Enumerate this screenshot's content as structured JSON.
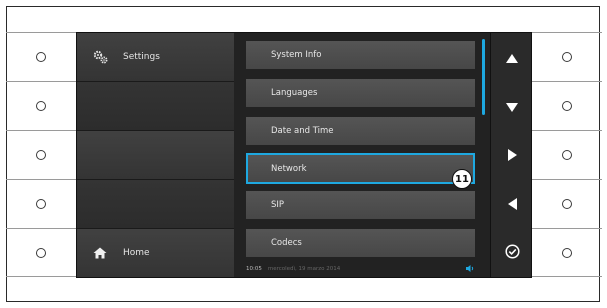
{
  "sidebar": {
    "settings_label": "Settings",
    "home_label": "Home"
  },
  "menu": {
    "items": [
      {
        "label": "System Info"
      },
      {
        "label": "Languages"
      },
      {
        "label": "Date and Time"
      },
      {
        "label": "Network"
      },
      {
        "label": "SIP"
      },
      {
        "label": "Codecs"
      }
    ],
    "selected": "Network",
    "callout_number": "11"
  },
  "status_bar": {
    "time": "10:05",
    "date": "mercoledì, 19 marzo 2014"
  },
  "nav": {
    "buttons": [
      "arrow-up-icon",
      "arrow-down-icon",
      "arrow-right-icon",
      "arrow-left-icon",
      "check-circle-icon"
    ]
  },
  "colors": {
    "accent": "#1ea8e0",
    "screen_bg": "#1a1a1a",
    "item_bg": "#505050"
  }
}
